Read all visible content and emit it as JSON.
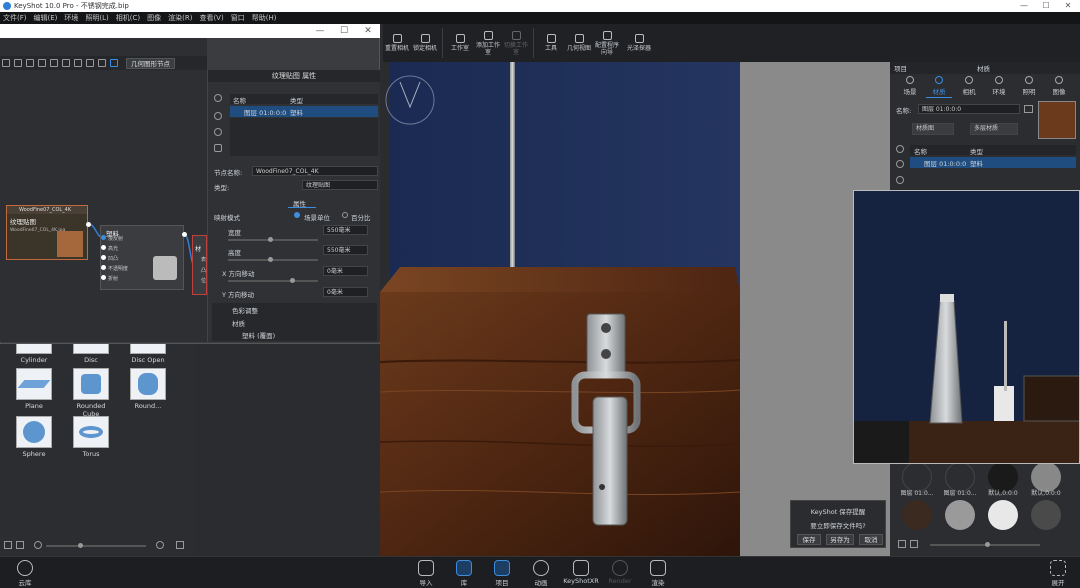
{
  "window": {
    "title": "KeyShot 10.0 Pro - 不锈钢完成.bip",
    "min": "—",
    "max": "☐",
    "close": "✕"
  },
  "menu": [
    "文件(F)",
    "编辑(E)",
    "环境",
    "照明(L)",
    "相机(C)",
    "图像",
    "渲染(R)",
    "查看(V)",
    "窗口",
    "帮助(H)"
  ],
  "toolbar": [
    {
      "label": "重置相机",
      "icon": "reset-camera-icon"
    },
    {
      "label": "锁定相机",
      "icon": "lock-camera-icon"
    },
    {
      "label": "工作室",
      "icon": "studio-icon"
    },
    {
      "label": "添加工作室",
      "icon": "add-studio-icon"
    },
    {
      "label": "切换工作室",
      "icon": "switch-studio-icon",
      "disabled": true
    },
    {
      "label": "工具",
      "icon": "tools-icon"
    },
    {
      "label": "几何视图",
      "icon": "geometry-view-icon"
    },
    {
      "label": "配置程序向导",
      "icon": "configurator-icon"
    },
    {
      "label": "光泽探器",
      "icon": "light-icon"
    }
  ],
  "material_graph": {
    "window_buttons": {
      "min": "—",
      "max": "☐",
      "close": "✕"
    },
    "tool_button": "几何图形节点",
    "node_texture": {
      "title": "WoodFine07_COL_4K",
      "label": "纹理贴图",
      "file": "WoodFine07_COL_4K.jpg"
    },
    "node_plastic": {
      "label": "塑料",
      "ports": [
        "漫反射",
        "高光",
        "凹凸",
        "不透明度",
        "折射"
      ]
    },
    "node_output": {
      "label": "材",
      "ports": [
        "表",
        "凸",
        "位"
      ]
    }
  },
  "props": {
    "header": "纹理贴图 属性",
    "col_name": "名称",
    "col_type": "类型",
    "row": {
      "name": "图层 01:0:0:0",
      "type": "塑料"
    },
    "node_name_label": "节点名称:",
    "node_name": "WoodFine07_COL_4K",
    "type_label": "类型:",
    "type_value": "纹理贴图",
    "tab": "属性",
    "mapping_label": "映射模式",
    "unit_option": "场景单位",
    "pct_option": "百分比",
    "width_label": "宽度",
    "width": "550毫米",
    "height_label": "高度",
    "height": "550毫米",
    "shift_x_label": "X 方向移动",
    "shift_x": "0毫米",
    "shift_y_label": "Y 方向移动",
    "shift_y": "0毫米",
    "tree": [
      "色彩调整",
      "材质",
      "塑料 (覆面)"
    ]
  },
  "library": {
    "items": [
      {
        "label": "Cylinder"
      },
      {
        "label": "Disc"
      },
      {
        "label": "Disc Open"
      },
      {
        "label": "Plane"
      },
      {
        "label": "Rounded Cube"
      },
      {
        "label": "Round..."
      },
      {
        "label": "Sphere"
      },
      {
        "label": "Torus"
      }
    ]
  },
  "right": {
    "header_left": "项目",
    "header_title": "材质",
    "tabs": [
      "场景",
      "材质",
      "相机",
      "环境",
      "照明",
      "图像"
    ],
    "name_label": "名称:",
    "name_value": "图层 01:0:0:0",
    "btn_graph": "材质图",
    "btn_multi": "多层材质",
    "col_name": "名称",
    "col_type": "类型",
    "row": {
      "name": "图层 01:0:0:0",
      "type": "塑料"
    },
    "materials": [
      "图层 01:0...",
      "图层 01:0...",
      "默认,0:0:0",
      "默认,0:0:0"
    ]
  },
  "dialog": {
    "title": "KeyShot 保存提醒",
    "message": "要立即保存文件吗?",
    "save": "保存",
    "save_as": "另存为",
    "cancel": "取消"
  },
  "bottom": {
    "library": "云库",
    "items": [
      {
        "label": "导入"
      },
      {
        "label": "库",
        "active": true
      },
      {
        "label": "项目",
        "active": true
      },
      {
        "label": "动画"
      },
      {
        "label": "KeyShotXR"
      },
      {
        "label": "Render",
        "disabled": true
      },
      {
        "label": "渲染"
      }
    ],
    "expand": "展开"
  }
}
